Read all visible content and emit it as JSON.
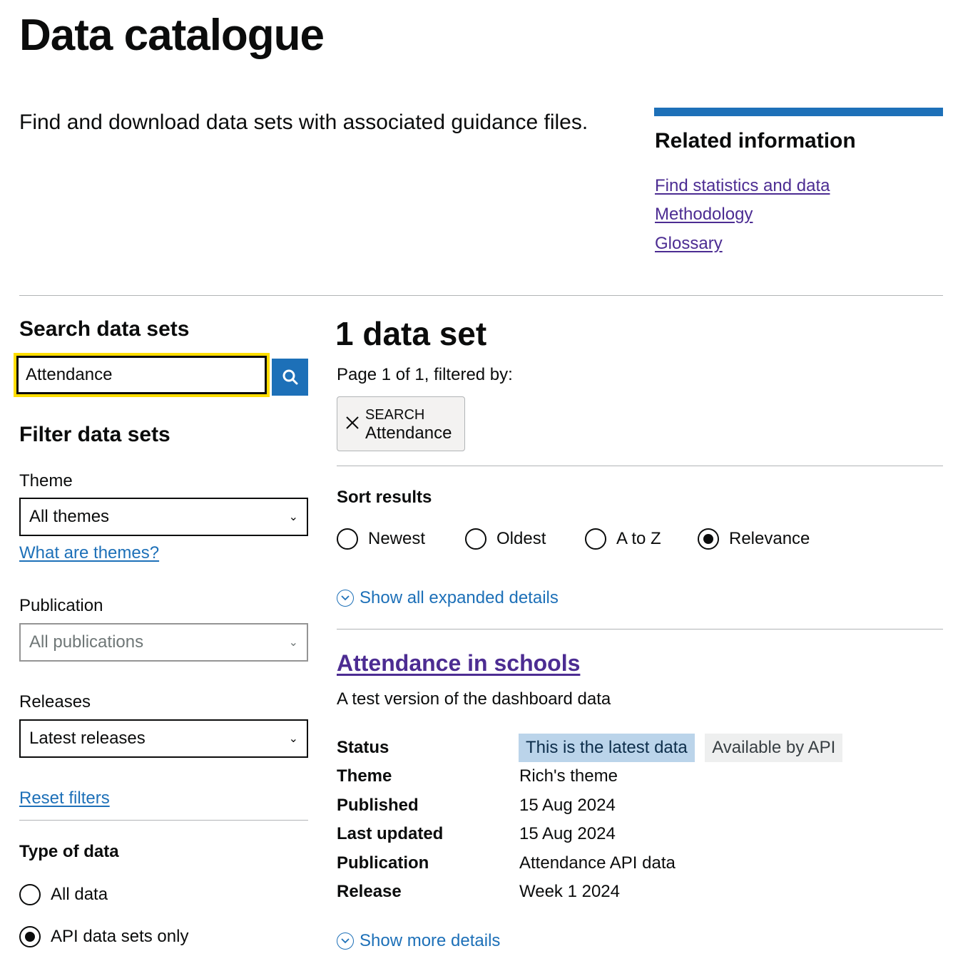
{
  "page": {
    "title": "Data catalogue",
    "lead": "Find and download data sets with associated guidance files."
  },
  "related": {
    "title": "Related information",
    "links": [
      "Find statistics and data",
      "Methodology",
      "Glossary"
    ]
  },
  "search": {
    "heading": "Search data sets",
    "value": "Attendance"
  },
  "filters": {
    "heading": "Filter data sets",
    "theme_label": "Theme",
    "theme_value": "All themes",
    "theme_help_link": "What are themes?",
    "publication_label": "Publication",
    "publication_value": "All publications",
    "releases_label": "Releases",
    "releases_value": "Latest releases",
    "reset_link": "Reset filters",
    "type_heading": "Type of data",
    "type_options": [
      "All data",
      "API data sets only"
    ],
    "type_selected": "API data sets only"
  },
  "results": {
    "count_heading": "1 data set",
    "page_info": "Page 1 of 1, filtered by:",
    "filter_tag": {
      "key": "SEARCH",
      "value": "Attendance"
    },
    "sort_heading": "Sort results",
    "sort_options": [
      "Newest",
      "Oldest",
      "A to Z",
      "Relevance"
    ],
    "sort_selected": "Relevance",
    "show_all_expanded": "Show all expanded details"
  },
  "dataset": {
    "title": "Attendance in schools",
    "summary": "A test version of the dashboard data",
    "terms": {
      "status": "Status",
      "theme": "Theme",
      "published": "Published",
      "last_updated": "Last updated",
      "publication": "Publication",
      "release": "Release"
    },
    "values": {
      "status_tags": [
        "This is the latest data",
        "Available by API"
      ],
      "theme": "Rich's theme",
      "published": "15 Aug 2024",
      "last_updated": "15 Aug 2024",
      "publication": "Attendance API data",
      "release": "Week 1 2024"
    },
    "show_more": "Show more details"
  },
  "colors": {
    "link_blue": "#1d70b8",
    "visited_purple": "#4c2c92",
    "focus_yellow": "#ffdd00",
    "tag_blue_bg": "#bbd4ea",
    "tag_grey_bg": "#eeefef"
  },
  "icons": [
    "search-icon",
    "close-icon",
    "chevron-down-icon",
    "chevron-circle-icon"
  ]
}
